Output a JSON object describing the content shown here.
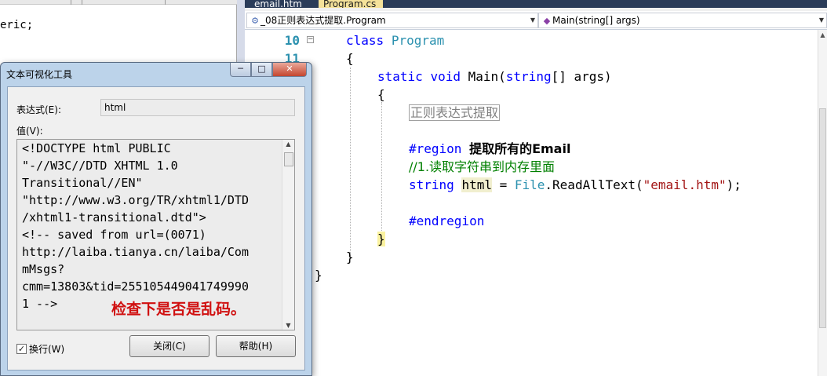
{
  "left_editor": {
    "code_fragment": "eric;"
  },
  "editor": {
    "tabs": [
      {
        "label": "email.htm",
        "active": false
      },
      {
        "label": "Program.cs",
        "active": true
      }
    ],
    "nav": {
      "class_combo": "_08正则表达式提取.Program",
      "member_combo": "Main(string[] args)"
    },
    "line_numbers": [
      "10",
      "11"
    ],
    "code": {
      "class_kw": "class",
      "class_name": "Program",
      "open_brace": "{",
      "static_kw": "static",
      "void_kw": "void",
      "main_sig": "Main(",
      "string_kw": "string",
      "main_args": "[] args)",
      "inner_open": "{",
      "collapsed_region": "正则表达式提取",
      "region_kw": "#region",
      "region_name": "提取所有的Email",
      "comment": "//1.读取字符串到内存里面",
      "string_type": "string",
      "var_name": "html",
      "assign": " = ",
      "file_type": "File",
      "method_call": ".ReadAllText(",
      "string_literal": "\"email.htm\"",
      "call_end": ");",
      "endregion_kw": "#endregion",
      "inner_close": "}",
      "outer_close": "}",
      "ns_close": "}"
    }
  },
  "dialog": {
    "title": "文本可视化工具",
    "caption_buttons": {
      "minimize": "─",
      "maximize": "□",
      "close": "✕"
    },
    "expression_label": "表达式(E):",
    "expression_value": "html",
    "value_label": "值(V):",
    "value_lines": [
      "<!DOCTYPE html PUBLIC",
      "\"-//W3C//DTD XHTML 1.0",
      "Transitional//EN\"",
      "\"http://www.w3.org/TR/xhtml1/DTD",
      "/xhtml1-transitional.dtd\">",
      "<!-- saved from url=(0071)",
      "http://laiba.tianya.cn/laiba/Com",
      "mMsgs?",
      "cmm=13803&tid=255105449041749990",
      "1 -->"
    ],
    "annotation": "检查下是否是乱码。",
    "wrap_label": "换行(W)",
    "wrap_checked": true,
    "close_button": "关闭(C)",
    "help_button": "帮助(H)"
  },
  "colors": {
    "keyword": "#0000ff",
    "type": "#2b91af",
    "string": "#a31515",
    "comment": "#008000",
    "annotation": "#d01010"
  }
}
